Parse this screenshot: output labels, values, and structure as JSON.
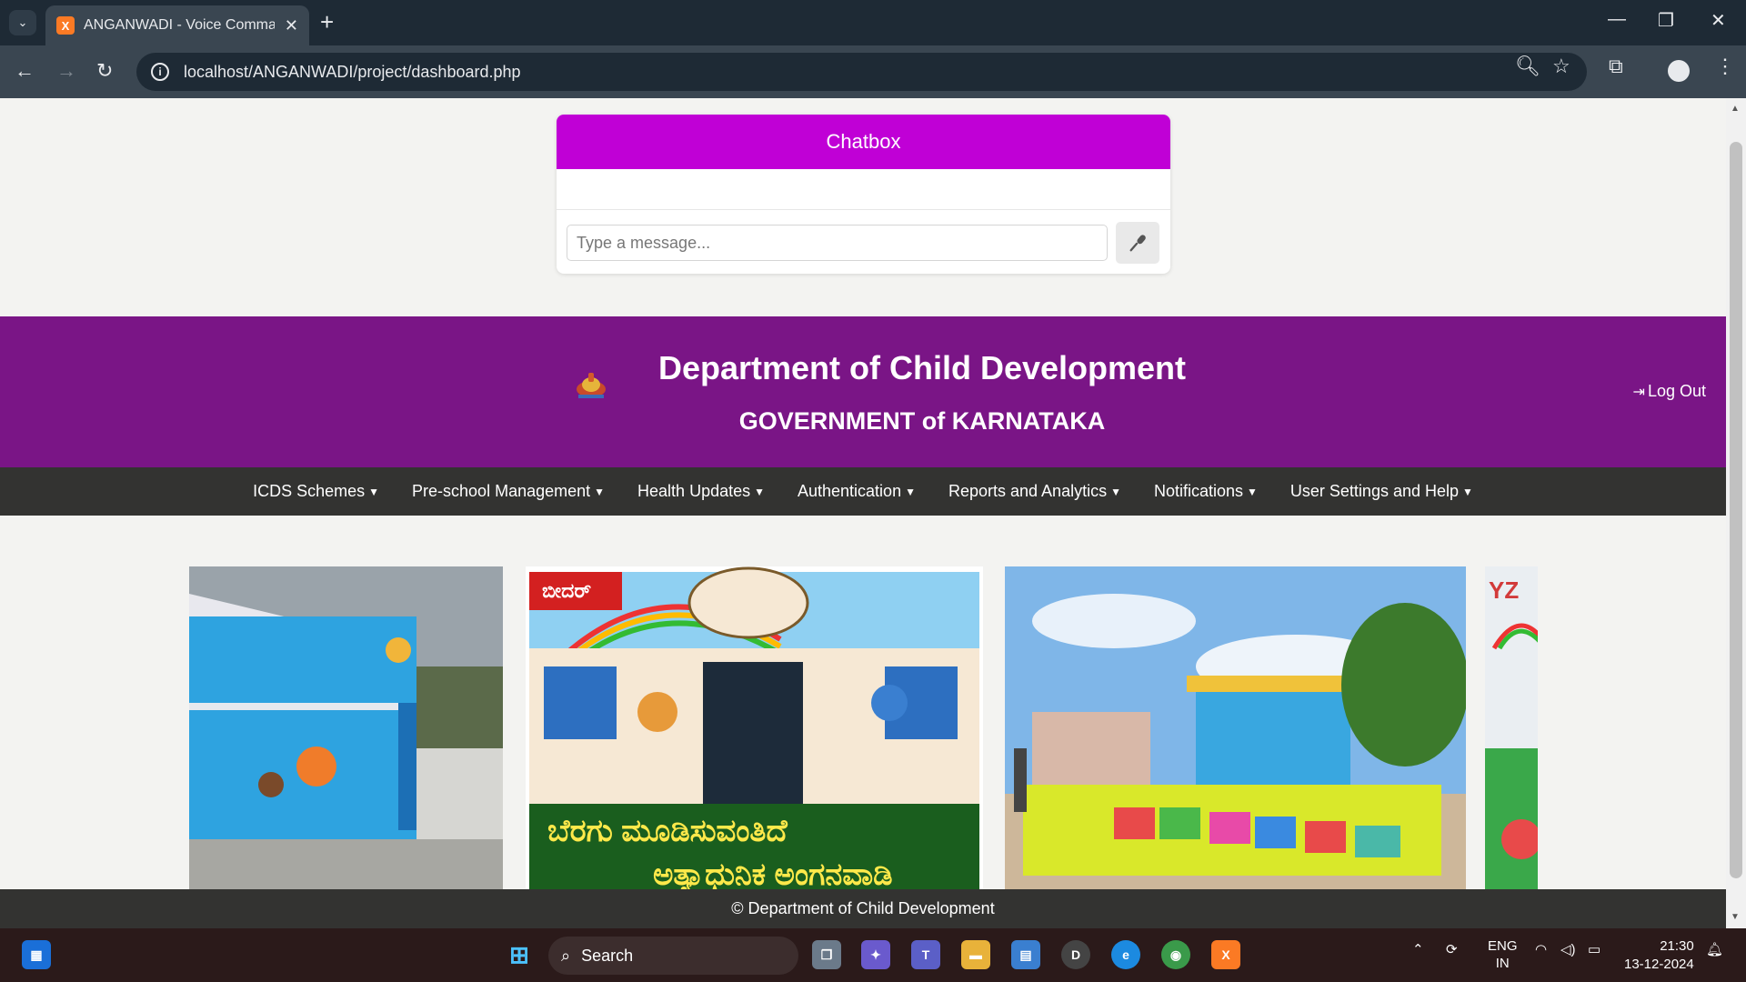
{
  "browser": {
    "tab_title": "ANGANWADI - Voice Command",
    "url": "localhost/ANGANWADI/project/dashboard.php"
  },
  "chat": {
    "title": "Chatbox",
    "placeholder": "Type a message..."
  },
  "header": {
    "title": "Department of Child Development",
    "subtitle": "GOVERNMENT of KARNATAKA",
    "logout_label": "Log Out"
  },
  "nav": {
    "items": [
      {
        "label": "ICDS Schemes"
      },
      {
        "label": "Pre-school Management"
      },
      {
        "label": "Health Updates"
      },
      {
        "label": "Authentication"
      },
      {
        "label": "Reports and Analytics"
      },
      {
        "label": "Notifications"
      },
      {
        "label": "User Settings and Help"
      }
    ]
  },
  "gallery": {
    "photo2_badge": "ಬೀದರ್",
    "photo2_caption_line1": "ಬೆರಗು ಮೂಡಿಸುವಂತಿದೆ",
    "photo2_caption_line2": "ಅತ್ಯಾಧುನಿಕ ಅಂಗನವಾಡಿ"
  },
  "footer": {
    "text": "© Department of Child Development"
  },
  "taskbar": {
    "search_label": "Search",
    "lang_line1": "ENG",
    "lang_line2": "IN",
    "time": "21:30",
    "date": "13-12-2024"
  },
  "colors": {
    "accent_magenta": "#c000d6",
    "header_purple": "#7a1586",
    "nav_dark": "#333331"
  }
}
